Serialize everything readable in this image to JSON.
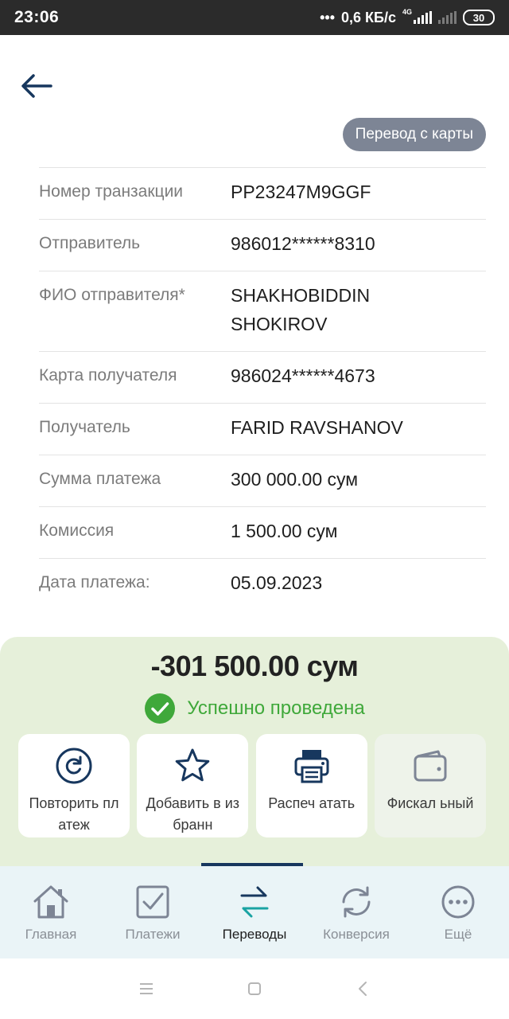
{
  "status_bar": {
    "time": "23:06",
    "speed": "0,6 КБ/с",
    "network": "4G",
    "battery": "30"
  },
  "header": {
    "back_icon": "arrow-left-icon",
    "chip_label": "Перевод с карты"
  },
  "details": [
    {
      "label": "Номер транзакции",
      "value": "PP23247M9GGF"
    },
    {
      "label": "Отправитель",
      "value": "986012******8310"
    },
    {
      "label": "ФИО отправителя*",
      "value": "SHAKHOBIDDIN SHOKIROV"
    },
    {
      "label": "Карта получателя",
      "value": "986024******4673"
    },
    {
      "label": "Получатель",
      "value": "FARID RAVSHANOV"
    },
    {
      "label": "Сумма платежа",
      "value": "300 000.00 сум"
    },
    {
      "label": "Комиссия",
      "value": "1 500.00 сум"
    },
    {
      "label": "Дата платежа:",
      "value": "05.09.2023"
    }
  ],
  "result": {
    "amount": "-301 500.00 сум",
    "status": "Успешно проведена",
    "status_color": "#3fa83a",
    "actions": [
      {
        "label": "Повторить платеж",
        "icon": "repeat-icon"
      },
      {
        "label": "Добавить в избранн",
        "icon": "star-icon"
      },
      {
        "label": "Распеч атать",
        "icon": "printer-icon"
      },
      {
        "label": "Фискал ьный",
        "icon": "wallet-icon"
      }
    ]
  },
  "bottom_nav": {
    "active_index": 2,
    "items": [
      {
        "label": "Главная",
        "icon": "home-icon"
      },
      {
        "label": "Платежи",
        "icon": "checkbox-icon"
      },
      {
        "label": "Переводы",
        "icon": "transfer-arrows-icon"
      },
      {
        "label": "Конверсия",
        "icon": "refresh-icon"
      },
      {
        "label": "Ещё",
        "icon": "more-dots-icon"
      }
    ]
  },
  "colors": {
    "accent_dark": "#17375e",
    "success": "#3fa83a",
    "panel_bg": "#e6f0da",
    "nav_bg": "#eaf4f7"
  }
}
